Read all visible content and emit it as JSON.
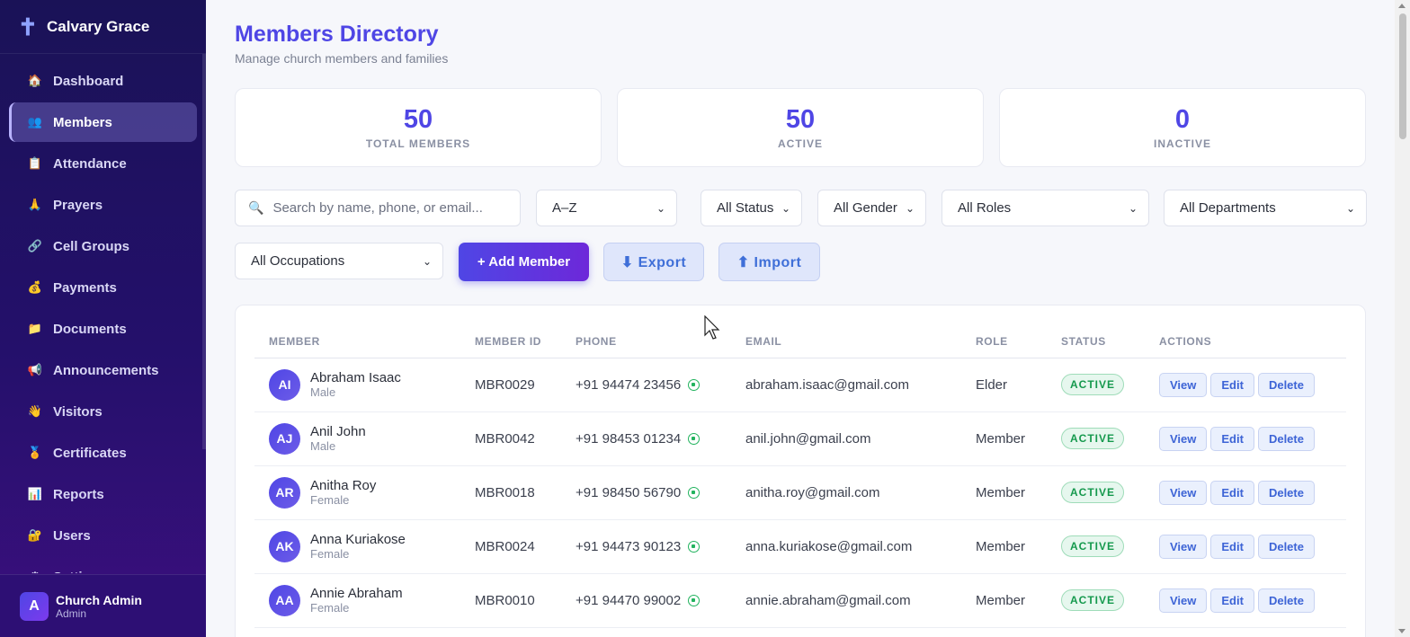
{
  "brand": {
    "icon": "cross-icon",
    "name": "Calvary Grace"
  },
  "sidebar": {
    "items": [
      {
        "label": "Dashboard",
        "icon": "home-icon",
        "glyph": "🏠",
        "active": false
      },
      {
        "label": "Members",
        "icon": "people-icon",
        "glyph": "👥",
        "active": true
      },
      {
        "label": "Attendance",
        "icon": "clipboard-icon",
        "glyph": "📋",
        "active": false
      },
      {
        "label": "Prayers",
        "icon": "praying-icon",
        "glyph": "🙏",
        "active": false
      },
      {
        "label": "Cell Groups",
        "icon": "link-icon",
        "glyph": "🔗",
        "active": false
      },
      {
        "label": "Payments",
        "icon": "money-bag-icon",
        "glyph": "💰",
        "active": false
      },
      {
        "label": "Documents",
        "icon": "folder-icon",
        "glyph": "📁",
        "active": false
      },
      {
        "label": "Announcements",
        "icon": "megaphone-icon",
        "glyph": "📢",
        "active": false
      },
      {
        "label": "Visitors",
        "icon": "wave-icon",
        "glyph": "👋",
        "active": false
      },
      {
        "label": "Certificates",
        "icon": "medal-icon",
        "glyph": "🏅",
        "active": false
      },
      {
        "label": "Reports",
        "icon": "bar-chart-icon",
        "glyph": "📊",
        "active": false
      },
      {
        "label": "Users",
        "icon": "lock-icon",
        "glyph": "🔐",
        "active": false
      },
      {
        "label": "Settings",
        "icon": "gear-icon",
        "glyph": "⚙",
        "active": false
      }
    ]
  },
  "user": {
    "initial": "A",
    "name": "Church Admin",
    "role": "Admin"
  },
  "page": {
    "title": "Members Directory",
    "subtitle": "Manage church members and families"
  },
  "stats": [
    {
      "value": "50",
      "label": "TOTAL MEMBERS"
    },
    {
      "value": "50",
      "label": "ACTIVE"
    },
    {
      "value": "0",
      "label": "INACTIVE"
    }
  ],
  "filters": {
    "search_placeholder": "Search by name, phone, or email...",
    "sort": "A–Z",
    "status": "All Status",
    "gender": "All Gender",
    "roles": "All Roles",
    "departments": "All Departments",
    "occupations": "All Occupations"
  },
  "actions": {
    "add": "+ Add Member",
    "export": "⬇ Export",
    "import": "⬆ Import"
  },
  "table": {
    "headers": [
      "MEMBER",
      "MEMBER ID",
      "PHONE",
      "EMAIL",
      "ROLE",
      "STATUS",
      "ACTIONS"
    ],
    "row_buttons": {
      "view": "View",
      "edit": "Edit",
      "delete": "Delete"
    },
    "rows": [
      {
        "initials": "AI",
        "name": "Abraham Isaac",
        "gender": "Male",
        "id": "MBR0029",
        "phone": "+91 94474 23456",
        "email": "abraham.isaac@gmail.com",
        "role": "Elder",
        "status": "ACTIVE"
      },
      {
        "initials": "AJ",
        "name": "Anil John",
        "gender": "Male",
        "id": "MBR0042",
        "phone": "+91 98453 01234",
        "email": "anil.john@gmail.com",
        "role": "Member",
        "status": "ACTIVE"
      },
      {
        "initials": "AR",
        "name": "Anitha Roy",
        "gender": "Female",
        "id": "MBR0018",
        "phone": "+91 98450 56790",
        "email": "anitha.roy@gmail.com",
        "role": "Member",
        "status": "ACTIVE"
      },
      {
        "initials": "AK",
        "name": "Anna Kuriakose",
        "gender": "Female",
        "id": "MBR0024",
        "phone": "+91 94473 90123",
        "email": "anna.kuriakose@gmail.com",
        "role": "Member",
        "status": "ACTIVE"
      },
      {
        "initials": "AA",
        "name": "Annie Abraham",
        "gender": "Female",
        "id": "MBR0010",
        "phone": "+91 94470 99002",
        "email": "annie.abraham@gmail.com",
        "role": "Member",
        "status": "ACTIVE"
      }
    ]
  },
  "colors": {
    "accent": "#4f46e5",
    "sidebar_top": "#1a1257",
    "sidebar_bottom": "#3b0f7e",
    "active_green": "#15994d",
    "link_blue": "#3d64d6"
  }
}
